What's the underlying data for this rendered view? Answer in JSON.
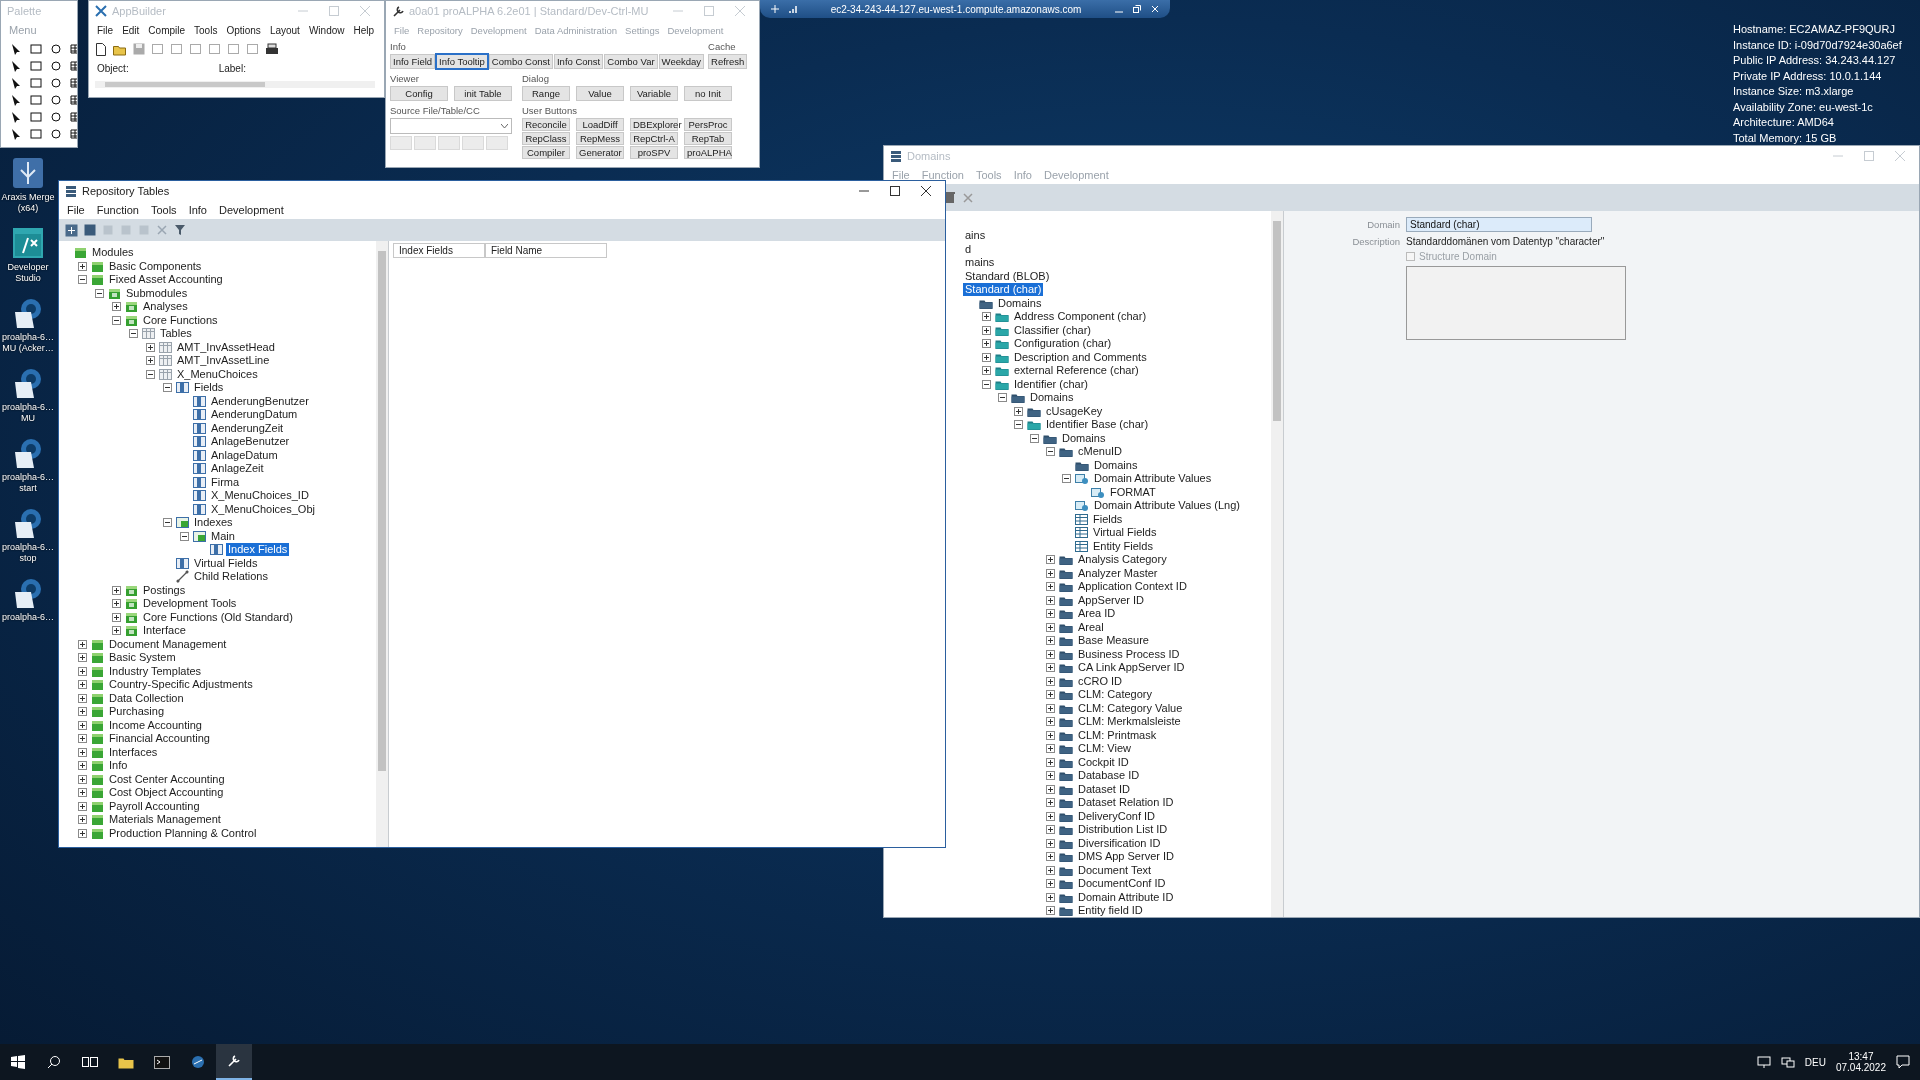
{
  "desktop": {
    "icons": [
      {
        "label": "Araxis Merge (x64)",
        "kind": "merge"
      },
      {
        "label": "Developer Studio",
        "kind": "studio"
      },
      {
        "label": "proalpha-6… MU (Acker…",
        "kind": "proalpha"
      },
      {
        "label": "proalpha-6… MU",
        "kind": "proalpha"
      },
      {
        "label": "proalpha-6… start",
        "kind": "proalpha"
      },
      {
        "label": "proalpha-6… stop",
        "kind": "proalpha"
      },
      {
        "label": "proalpha-6…",
        "kind": "proalpha"
      }
    ],
    "info_lines": [
      "Hostname: EC2AMAZ-PF9QURJ",
      "Instance ID: i-09d70d7924e30a6ef",
      "Public IP Address: 34.243.44.127",
      "Private IP Address: 10.0.1.144",
      "Instance Size: m3.xlarge",
      "Availability Zone: eu-west-1c",
      "Architecture: AMD64",
      "Total Memory: 15 GB"
    ]
  },
  "remote_bar": {
    "host": "ec2-34-243-44-127.eu-west-1.compute.amazonaws.com"
  },
  "palette": {
    "title": "Palette",
    "menu": "Menu"
  },
  "appbuilder": {
    "title": "AppBuilder",
    "menus": [
      "File",
      "Edit",
      "Compile",
      "Tools",
      "Options",
      "Layout",
      "Window",
      "Help"
    ],
    "object_label": "Object:",
    "label_label": "Label:"
  },
  "proalpha": {
    "title": "a0a01 proALPHA 6.2e01 | Standard/Dev-Ctrl-MU",
    "menus": [
      "File",
      "Repository",
      "Development",
      "Data Administration",
      "Settings",
      "Development"
    ],
    "info": {
      "title": "Info",
      "buttons": [
        {
          "label": "Info Field",
          "focused": false
        },
        {
          "label": "Info Tooltip",
          "focused": true
        },
        {
          "label": "Combo Const",
          "focused": false
        },
        {
          "label": "Info Const",
          "focused": false
        },
        {
          "label": "Combo Var",
          "focused": false
        },
        {
          "label": "Weekday",
          "focused": false
        }
      ]
    },
    "cache": {
      "title": "Cache",
      "button": "Refresh"
    },
    "viewer": {
      "title": "Viewer",
      "buttons": [
        "Config",
        "init Table"
      ]
    },
    "dialog": {
      "title": "Dialog",
      "buttons": [
        "Range",
        "Value",
        "Variable",
        "no Init"
      ]
    },
    "source": {
      "title": "Source File/Table/CC"
    },
    "user_buttons": {
      "title": "User Buttons",
      "buttons": [
        "Reconcile",
        "LoadDiff",
        "DBExplorer",
        "PersProc",
        "RepClass",
        "RepMess",
        "RepCtrl-A",
        "RepTab",
        "Compiler",
        "Generator",
        "proSPV",
        "proALPHA"
      ]
    }
  },
  "repository_tables": {
    "title": "Repository Tables",
    "menus": [
      "File",
      "Function",
      "Tools",
      "Info",
      "Development"
    ],
    "tree": [
      {
        "label": "Modules",
        "kind": "module",
        "selected": false,
        "children": [
          {
            "label": "Basic Components",
            "kind": "module",
            "selected": false,
            "expanded": false
          },
          {
            "label": "Fixed Asset Accounting",
            "kind": "module",
            "selected": false,
            "expanded": true,
            "children": [
              {
                "label": "Submodules",
                "kind": "submodule",
                "selected": false,
                "expanded": true,
                "children": [
                  {
                    "label": "Analyses",
                    "kind": "submodule",
                    "selected": false,
                    "expanded": false
                  },
                  {
                    "label": "Core Functions",
                    "kind": "submodule",
                    "selected": false,
                    "expanded": true,
                    "children": [
                      {
                        "label": "Tables",
                        "kind": "table",
                        "selected": false,
                        "expanded": true,
                        "children": [
                          {
                            "label": "AMT_InvAssetHead",
                            "kind": "table",
                            "selected": false,
                            "expanded": false
                          },
                          {
                            "label": "AMT_InvAssetLine",
                            "kind": "table",
                            "selected": false,
                            "expanded": false
                          },
                          {
                            "label": "X_MenuChoices",
                            "kind": "table",
                            "selected": false,
                            "expanded": true,
                            "children": [
                              {
                                "label": "Fields",
                                "kind": "field",
                                "selected": false,
                                "expanded": true,
                                "children": [
                                  {
                                    "label": "AenderungBenutzer",
                                    "kind": "field",
                                    "selected": false
                                  },
                                  {
                                    "label": "AenderungDatum",
                                    "kind": "field",
                                    "selected": false
                                  },
                                  {
                                    "label": "AenderungZeit",
                                    "kind": "field",
                                    "selected": false
                                  },
                                  {
                                    "label": "AnlageBenutzer",
                                    "kind": "field",
                                    "selected": false
                                  },
                                  {
                                    "label": "AnlageDatum",
                                    "kind": "field",
                                    "selected": false
                                  },
                                  {
                                    "label": "AnlageZeit",
                                    "kind": "field",
                                    "selected": false
                                  },
                                  {
                                    "label": "Firma",
                                    "kind": "field",
                                    "selected": false
                                  },
                                  {
                                    "label": "X_MenuChoices_ID",
                                    "kind": "field",
                                    "selected": false
                                  },
                                  {
                                    "label": "X_MenuChoices_Obj",
                                    "kind": "field",
                                    "selected": false
                                  }
                                ]
                              },
                              {
                                "label": "Indexes",
                                "kind": "index",
                                "selected": false,
                                "expanded": true,
                                "children": [
                                  {
                                    "label": "Main",
                                    "kind": "index",
                                    "selected": false,
                                    "expanded": true,
                                    "children": [
                                      {
                                        "label": "Index Fields",
                                        "kind": "field",
                                        "selected": true
                                      }
                                    ]
                                  }
                                ]
                              },
                              {
                                "label": "Virtual Fields",
                                "kind": "field",
                                "selected": false
                              },
                              {
                                "label": "Child Relations",
                                "kind": "relation",
                                "selected": false
                              }
                            ]
                          }
                        ]
                      }
                    ]
                  },
                  {
                    "label": "Postings",
                    "kind": "submodule",
                    "selected": false,
                    "expanded": false
                  },
                  {
                    "label": "Development Tools",
                    "kind": "submodule",
                    "selected": false,
                    "expanded": false
                  },
                  {
                    "label": "Core Functions (Old Standard)",
                    "kind": "submodule",
                    "selected": false,
                    "expanded": false
                  },
                  {
                    "label": "Interface",
                    "kind": "submodule",
                    "selected": false,
                    "expanded": false
                  }
                ]
              }
            ]
          },
          {
            "label": "Document Management",
            "kind": "module",
            "selected": false,
            "expanded": false
          },
          {
            "label": "Basic System",
            "kind": "module",
            "selected": false,
            "expanded": false
          },
          {
            "label": "Industry Templates",
            "kind": "module",
            "selected": false,
            "expanded": false
          },
          {
            "label": "Country-Specific Adjustments",
            "kind": "module",
            "selected": false,
            "expanded": false
          },
          {
            "label": "Data Collection",
            "kind": "module",
            "selected": false,
            "expanded": false
          },
          {
            "label": "Purchasing",
            "kind": "module",
            "selected": false,
            "expanded": false
          },
          {
            "label": "Income Accounting",
            "kind": "module",
            "selected": false,
            "expanded": false
          },
          {
            "label": "Financial Accounting",
            "kind": "module",
            "selected": false,
            "expanded": false
          },
          {
            "label": "Interfaces",
            "kind": "module",
            "selected": false,
            "expanded": false
          },
          {
            "label": "Info",
            "kind": "module",
            "selected": false,
            "expanded": false
          },
          {
            "label": "Cost Center Accounting",
            "kind": "module",
            "selected": false,
            "expanded": false
          },
          {
            "label": "Cost Object Accounting",
            "kind": "module",
            "selected": false,
            "expanded": false
          },
          {
            "label": "Payroll Accounting",
            "kind": "module",
            "selected": false,
            "expanded": false
          },
          {
            "label": "Materials Management",
            "kind": "module",
            "selected": false,
            "expanded": false
          },
          {
            "label": "Production Planning & Control",
            "kind": "module",
            "selected": false,
            "expanded": false
          }
        ]
      }
    ],
    "columns": [
      "Index Fields",
      "Field Name"
    ]
  },
  "domains": {
    "title": "Domains",
    "menus": [
      "File",
      "Function",
      "Tools",
      "Info",
      "Development"
    ],
    "tree": [
      {
        "label": "ains",
        "selected": false
      },
      {
        "label": "d",
        "selected": false
      },
      {
        "label": "mains",
        "selected": false
      },
      {
        "label": "Standard (BLOB)",
        "selected": false
      },
      {
        "label": "Standard (char)",
        "selected": true,
        "children": [
          {
            "label": "Domains",
            "kind": "folder",
            "selected": false,
            "children": [
              {
                "label": "Address Component (char)",
                "kind": "domain",
                "selected": false,
                "expanded": false
              },
              {
                "label": "Classifier (char)",
                "kind": "domain",
                "selected": false,
                "expanded": false
              },
              {
                "label": "Configuration (char)",
                "kind": "domain",
                "selected": false,
                "expanded": false
              },
              {
                "label": "Description and Comments",
                "kind": "domain",
                "selected": false,
                "expanded": false
              },
              {
                "label": "external Reference (char)",
                "kind": "domain",
                "selected": false,
                "expanded": false
              },
              {
                "label": "Identifier (char)",
                "kind": "domain",
                "selected": false,
                "expanded": true,
                "children": [
                  {
                    "label": "Domains",
                    "kind": "folder",
                    "selected": false,
                    "expanded": true,
                    "children": [
                      {
                        "label": "cUsageKey",
                        "kind": "folder",
                        "selected": false,
                        "expanded": false
                      },
                      {
                        "label": "Identifier Base (char)",
                        "kind": "domain",
                        "selected": false,
                        "expanded": true,
                        "children": [
                          {
                            "label": "Domains",
                            "kind": "folder",
                            "selected": false,
                            "expanded": true,
                            "children": [
                              {
                                "label": "cMenuID",
                                "kind": "folder",
                                "selected": false,
                                "expanded": true,
                                "children": [
                                  {
                                    "label": "Domains",
                                    "kind": "folder",
                                    "selected": false
                                  },
                                  {
                                    "label": "Domain Attribute Values",
                                    "kind": "attribute",
                                    "selected": false,
                                    "expanded": true,
                                    "children": [
                                      {
                                        "label": "FORMAT",
                                        "kind": "attribute",
                                        "selected": false
                                      }
                                    ]
                                  },
                                  {
                                    "label": "Domain Attribute Values (Lng)",
                                    "kind": "attribute",
                                    "selected": false
                                  },
                                  {
                                    "label": "Fields",
                                    "kind": "grid",
                                    "selected": false
                                  },
                                  {
                                    "label": "Virtual Fields",
                                    "kind": "grid",
                                    "selected": false
                                  },
                                  {
                                    "label": "Entity Fields",
                                    "kind": "grid",
                                    "selected": false
                                  }
                                ]
                              },
                              {
                                "label": "Analysis Category",
                                "kind": "folder",
                                "selected": false,
                                "expanded": false
                              },
                              {
                                "label": "Analyzer Master",
                                "kind": "folder",
                                "selected": false,
                                "expanded": false
                              },
                              {
                                "label": "Application Context ID",
                                "kind": "folder",
                                "selected": false,
                                "expanded": false
                              },
                              {
                                "label": "AppServer ID",
                                "kind": "folder",
                                "selected": false,
                                "expanded": false
                              },
                              {
                                "label": "Area ID",
                                "kind": "folder",
                                "selected": false,
                                "expanded": false
                              },
                              {
                                "label": "Areal",
                                "kind": "folder",
                                "selected": false,
                                "expanded": false
                              },
                              {
                                "label": "Base Measure",
                                "kind": "folder",
                                "selected": false,
                                "expanded": false
                              },
                              {
                                "label": "Business Process ID",
                                "kind": "folder",
                                "selected": false,
                                "expanded": false
                              },
                              {
                                "label": "CA Link AppServer ID",
                                "kind": "folder",
                                "selected": false,
                                "expanded": false
                              },
                              {
                                "label": "cCRO ID",
                                "kind": "folder",
                                "selected": false,
                                "expanded": false
                              },
                              {
                                "label": "CLM: Category",
                                "kind": "folder",
                                "selected": false,
                                "expanded": false
                              },
                              {
                                "label": "CLM: Category Value",
                                "kind": "folder",
                                "selected": false,
                                "expanded": false
                              },
                              {
                                "label": "CLM: Merkmalsleiste",
                                "kind": "folder",
                                "selected": false,
                                "expanded": false
                              },
                              {
                                "label": "CLM: Printmask",
                                "kind": "folder",
                                "selected": false,
                                "expanded": false
                              },
                              {
                                "label": "CLM: View",
                                "kind": "folder",
                                "selected": false,
                                "expanded": false
                              },
                              {
                                "label": "Cockpit ID",
                                "kind": "folder",
                                "selected": false,
                                "expanded": false
                              },
                              {
                                "label": "Database ID",
                                "kind": "folder",
                                "selected": false,
                                "expanded": false
                              },
                              {
                                "label": "Dataset ID",
                                "kind": "folder",
                                "selected": false,
                                "expanded": false
                              },
                              {
                                "label": "Dataset Relation ID",
                                "kind": "folder",
                                "selected": false,
                                "expanded": false
                              },
                              {
                                "label": "DeliveryConf ID",
                                "kind": "folder",
                                "selected": false,
                                "expanded": false
                              },
                              {
                                "label": "Distribution List ID",
                                "kind": "folder",
                                "selected": false,
                                "expanded": false
                              },
                              {
                                "label": "Diversification ID",
                                "kind": "folder",
                                "selected": false,
                                "expanded": false
                              },
                              {
                                "label": "DMS App Server ID",
                                "kind": "folder",
                                "selected": false,
                                "expanded": false
                              },
                              {
                                "label": "Document Text",
                                "kind": "folder",
                                "selected": false,
                                "expanded": false
                              },
                              {
                                "label": "DocumentConf ID",
                                "kind": "folder",
                                "selected": false,
                                "expanded": false
                              },
                              {
                                "label": "Domain Attribute ID",
                                "kind": "folder",
                                "selected": false,
                                "expanded": false
                              },
                              {
                                "label": "Entity field ID",
                                "kind": "folder",
                                "selected": false,
                                "expanded": false
                              }
                            ]
                          }
                        ]
                      }
                    ]
                  }
                ]
              }
            ]
          }
        ]
      }
    ],
    "form": {
      "domain_label": "Domain",
      "domain_value": "Standard (char)",
      "description_label": "Description",
      "description_value": "Standarddomänen vom Datentyp \"character\"",
      "structure_label": "Structure Domain",
      "structure_checked": false
    }
  },
  "taskbar": {
    "language": "DEU",
    "time": "13:47",
    "date": "07.04.2022"
  }
}
